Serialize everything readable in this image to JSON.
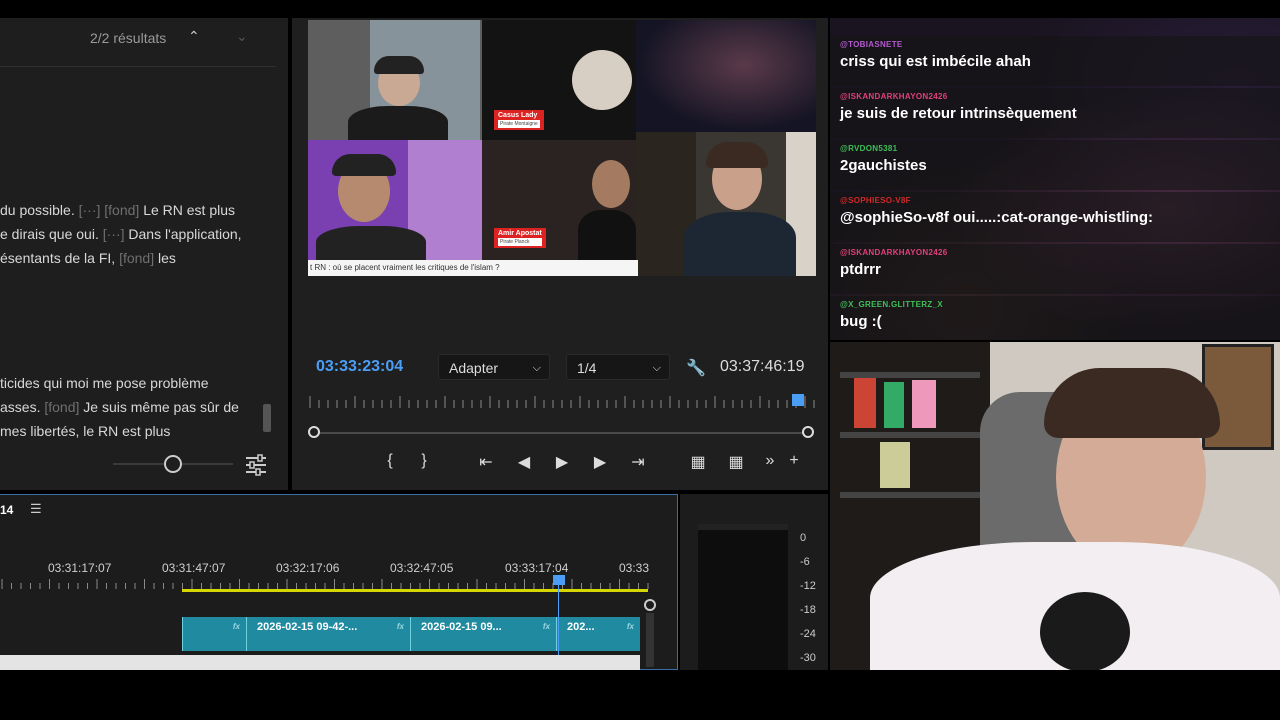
{
  "transcript": {
    "results": "2/2 résultats",
    "lines": [
      {
        "text": "du possible.",
        "tag": "[···] [fond]",
        "after": "Le RN est plus"
      },
      {
        "text": "e dirais que oui.",
        "tag": "[···]",
        "after": "Dans l'application,"
      },
      {
        "text": "ésentants de la FI,",
        "tag": "[fond]",
        "after": "les"
      },
      {
        "text": "ticides qui moi me pose problème",
        "tag": "",
        "after": ""
      },
      {
        "text": "asses.",
        "tag": "[fond]",
        "after": "Je suis même pas sûr de"
      },
      {
        "text": "mes libertés, le RN est plus",
        "tag": "",
        "after": ""
      }
    ]
  },
  "monitor": {
    "current_timecode": "03:33:23:04",
    "fit_option": "Adapter",
    "resolution_option": "1/4",
    "duration_timecode": "03:37:46:19",
    "preview": {
      "guest1_name": "Casus Lady",
      "guest1_sub": "Pirate Montaigne",
      "guest2_name": "Amir Apostat",
      "guest2_sub": "Pirate Planck",
      "caption": "t RN : où se placent vraiment les critiques de l'islam ?"
    }
  },
  "timeline": {
    "sequence_label": "14",
    "timecodes": [
      "03:31:17:07",
      "03:31:47:07",
      "03:32:17:06",
      "03:32:47:05",
      "03:33:17:04",
      "03:33"
    ],
    "clips": [
      "2026-02-15 09-42-...",
      "2026-02-15 09...",
      "202..."
    ],
    "fx_label": "fx"
  },
  "meter": {
    "scale": [
      "0",
      "-6",
      "-12",
      "-18",
      "-24",
      "-30"
    ]
  },
  "chat": {
    "messages": [
      {
        "user": "@TOBIASNETE",
        "text": "criss qui est imbécile ahah",
        "color": "#b45ad0"
      },
      {
        "user": "@ISKANDARKHAYON2426",
        "text": "je suis de retour intrinsèquement",
        "color": "#e0407a"
      },
      {
        "user": "@RVDON5381",
        "text": "2gauchistes",
        "color": "#3fbf5a"
      },
      {
        "user": "@SOPHIESO-V8F",
        "text": "@sophieSo-v8f oui.....:cat-orange-whistling:",
        "color": "#d02828"
      },
      {
        "user": "@ISKANDARKHAYON2426",
        "text": "ptdrrr",
        "color": "#e0407a"
      },
      {
        "user": "@X_GREEN.GLITTERZ_X",
        "text": "bug :(",
        "color": "#3fbf5a"
      }
    ]
  },
  "icons": {
    "search_prev": "chevron-up-icon",
    "search_next": "chevron-down-icon",
    "settings": "sliders-icon",
    "wrench": "wrench-icon",
    "transport": [
      "mark-in-icon",
      "mark-out-icon",
      "go-to-in-icon",
      "step-back-icon",
      "play-icon",
      "step-forward-icon",
      "go-to-out-icon",
      "lift-icon",
      "extract-icon",
      "more-icon",
      "add-icon"
    ]
  }
}
